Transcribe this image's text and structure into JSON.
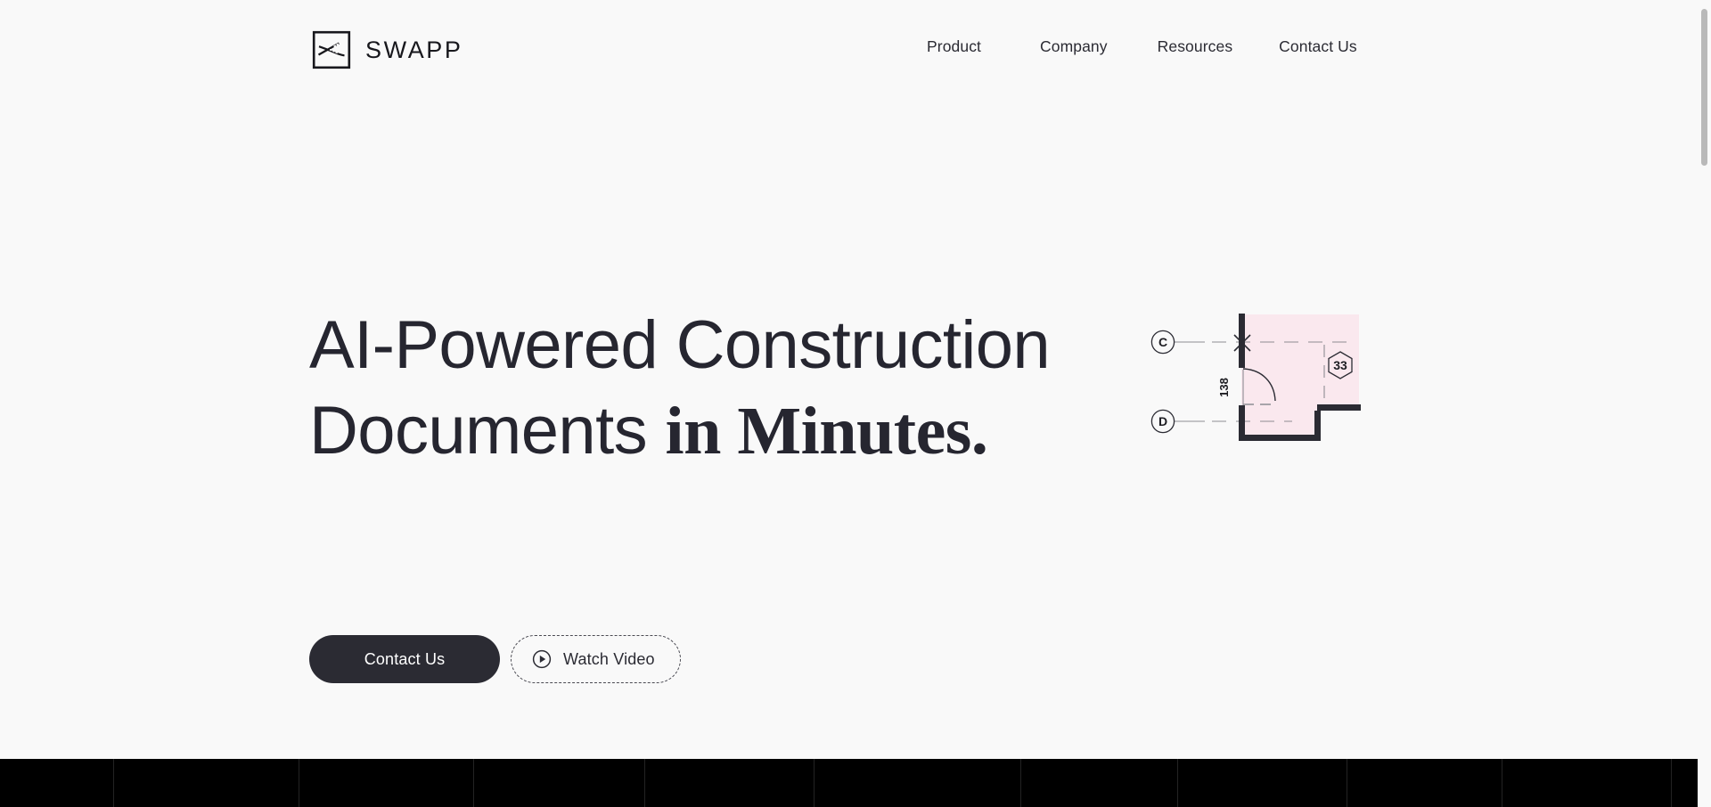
{
  "brand": {
    "name": "SWAPP",
    "mark_icon": "swapp-square-logo-icon"
  },
  "nav": {
    "items": [
      {
        "label": "Product"
      },
      {
        "label": "Company"
      },
      {
        "label": "Resources"
      },
      {
        "label": "Contact Us"
      }
    ]
  },
  "hero": {
    "headline_line1": "AI-Powered Construction",
    "headline_line2_regular": "Documents ",
    "headline_line2_accent": "in Minutes.",
    "primary_button": {
      "label": "Contact Us"
    },
    "secondary_button": {
      "label": "Watch Video",
      "icon": "play-circle-icon"
    }
  },
  "floorplan": {
    "grid_bubbles": [
      {
        "label": "C"
      },
      {
        "label": "D"
      }
    ],
    "dimension_label": "138",
    "room_tag": "33",
    "room_fill_color": "#fae8ee",
    "wall_color": "#2b2b33",
    "line_color": "#8d8d93"
  },
  "logo_band": {
    "background_color": "#000000",
    "cell_count": 11
  },
  "colors": {
    "page_background": "#f9f9f9",
    "text": "#2b2b33",
    "primary_button_bg": "#2b2b33",
    "accent_pink": "#fae8ee"
  },
  "scrollbar": {
    "position": "right"
  }
}
